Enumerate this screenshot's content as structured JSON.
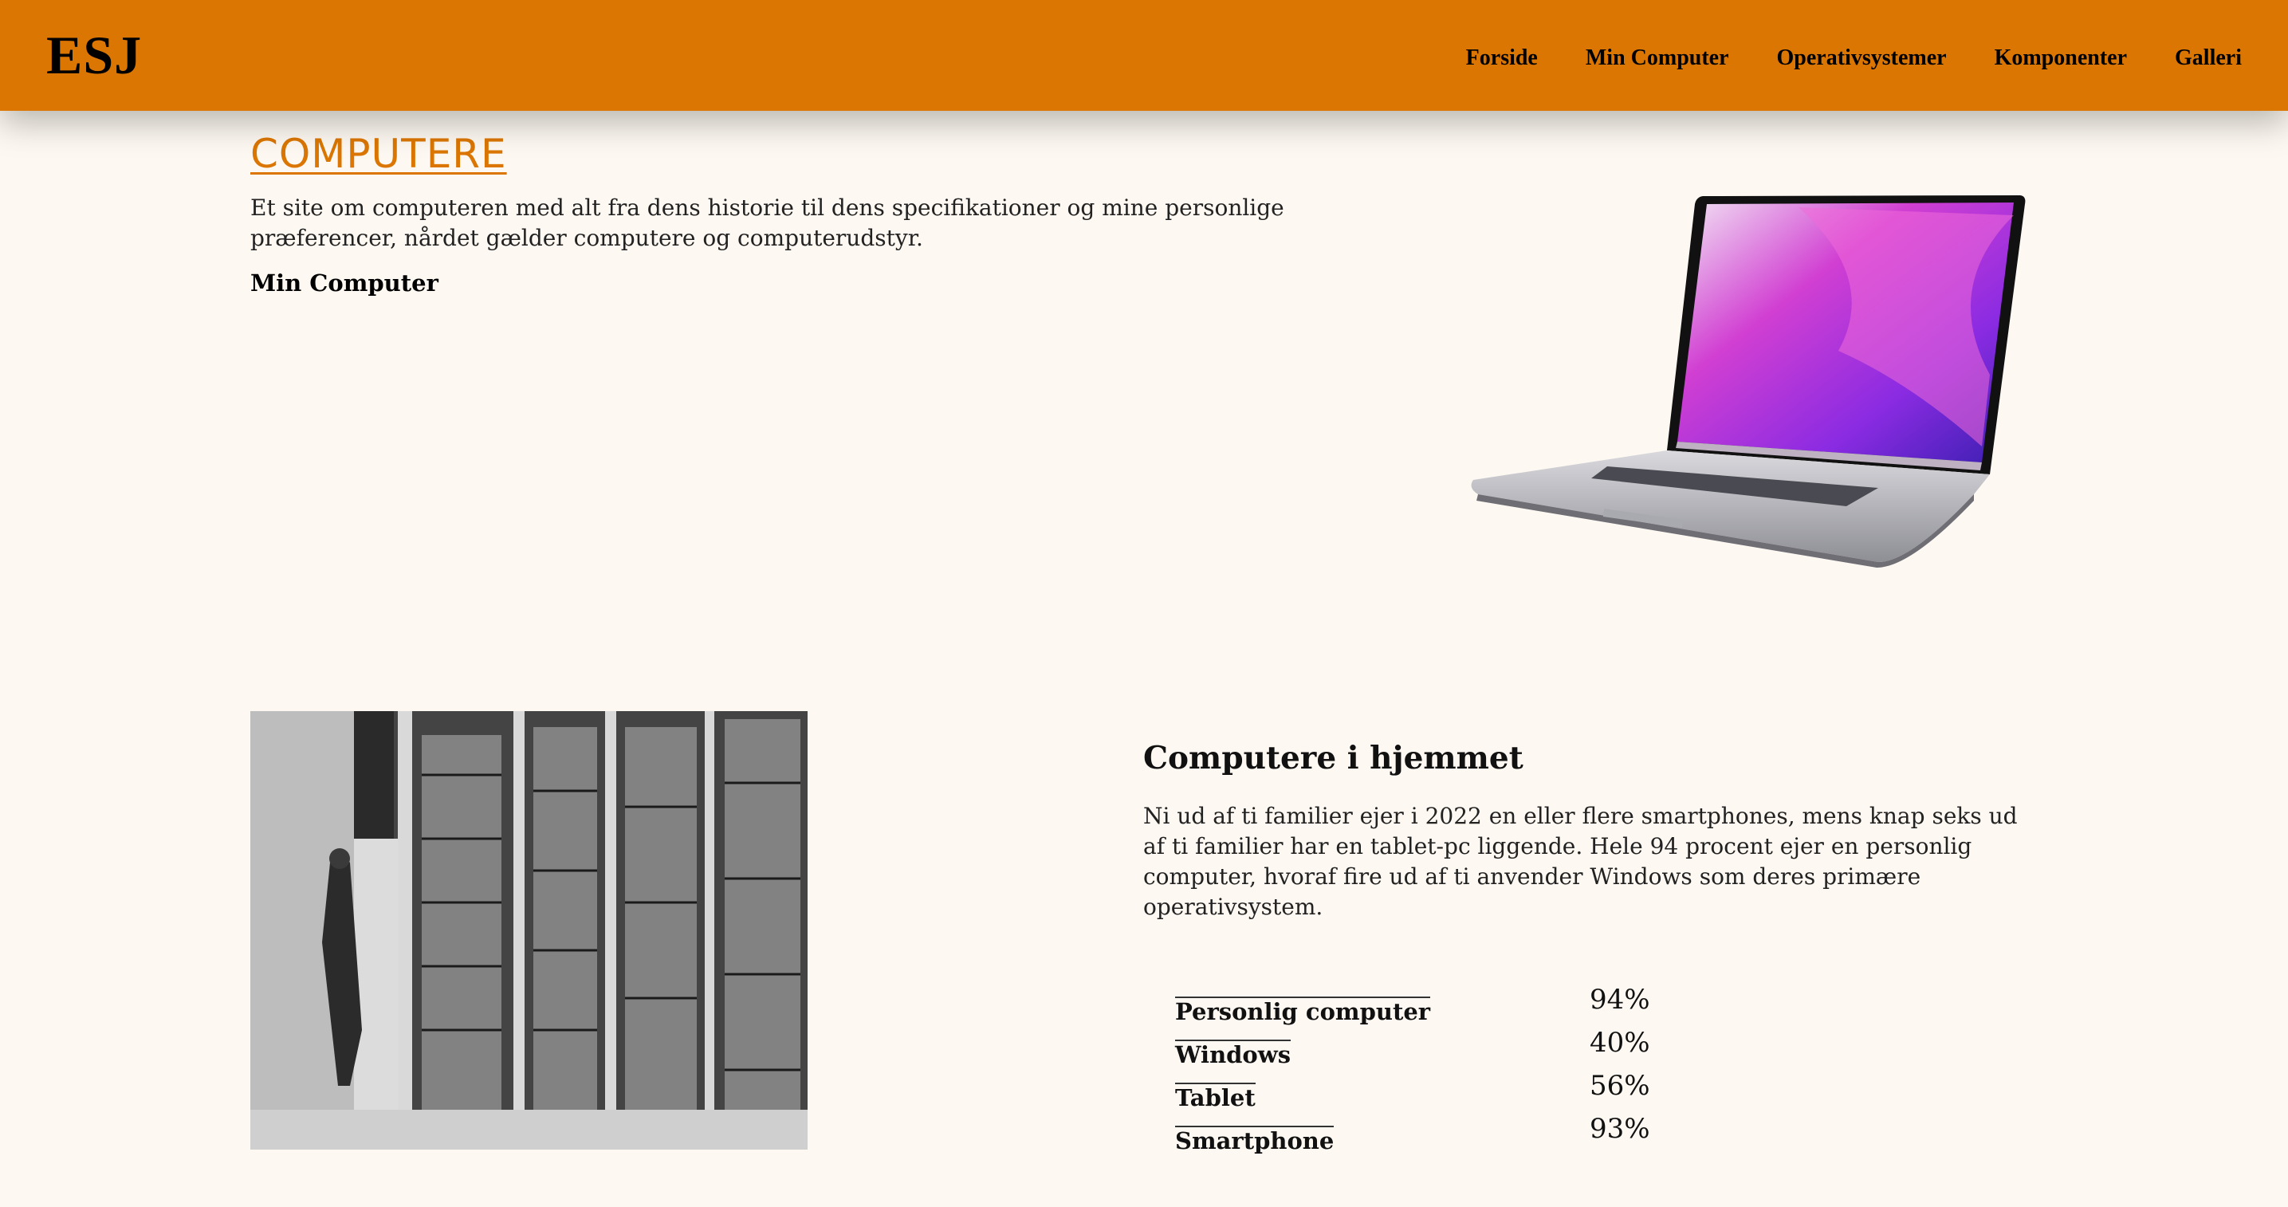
{
  "header": {
    "logo": "ESJ",
    "nav": [
      "Forside",
      "Min Computer",
      "Operativsystemer",
      "Komponenter",
      "Galleri"
    ]
  },
  "hero": {
    "title": "COMPUTERE",
    "description": "Et site om computeren med alt fra dens historie til dens specifikationer og mine personlige præferencer, nårdet gælder computere og computerudstyr.",
    "link": "Min Computer"
  },
  "section": {
    "title": "Computere i hjemmet",
    "text": "Ni ud af ti familier ejer i 2022 en eller flere smartphones, mens knap seks ud af ti familier har en tablet-pc liggende. Hele 94 procent ejer en personlig computer, hvoraf fire ud af ti anvender Windows som deres primære operativsystem."
  },
  "stats": [
    {
      "label": "Personlig computer",
      "value": "94%"
    },
    {
      "label": "Windows",
      "value": "40%"
    },
    {
      "label": "Tablet",
      "value": "56%"
    },
    {
      "label": "Smartphone",
      "value": "93%"
    }
  ],
  "colors": {
    "accent": "#db7602",
    "background": "#fdf8f1"
  }
}
